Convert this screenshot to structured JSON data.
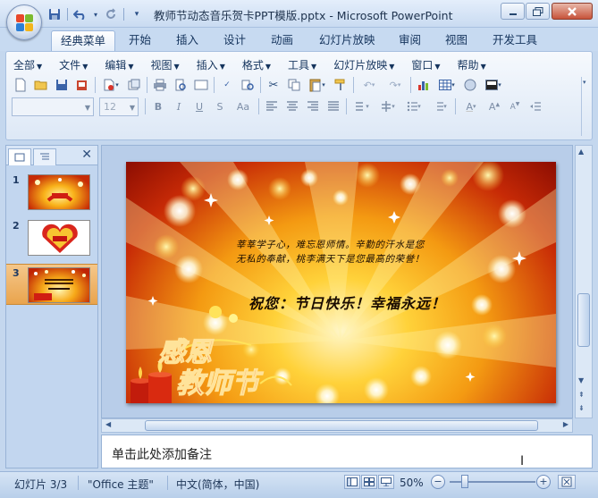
{
  "window": {
    "title": "教师节动态音乐贺卡PPT模版.pptx - Microsoft PowerPoint",
    "controls": [
      "minimize-icon",
      "maximize-icon",
      "close-icon"
    ]
  },
  "quick_access": {
    "icons": [
      "save-icon",
      "undo-icon",
      "redo-icon",
      "customize-icon"
    ]
  },
  "ribbon_tabs": [
    {
      "label": "经典菜单",
      "active": true
    },
    {
      "label": "开始"
    },
    {
      "label": "插入"
    },
    {
      "label": "设计"
    },
    {
      "label": "动画"
    },
    {
      "label": "幻灯片放映"
    },
    {
      "label": "审阅"
    },
    {
      "label": "视图"
    },
    {
      "label": "开发工具"
    }
  ],
  "classic_menu": [
    "全部",
    "文件",
    "编辑",
    "视图",
    "插入",
    "格式",
    "工具",
    "幻灯片放映",
    "窗口",
    "帮助"
  ],
  "toolbar": {
    "font_name": "",
    "font_size": "12",
    "font_style_labels": [
      "B",
      "I",
      "U",
      "S",
      "Aa"
    ]
  },
  "slide_panel": {
    "tab_icons": [
      "slides-tab-icon",
      "outline-tab-icon"
    ],
    "slides": [
      {
        "number": "1"
      },
      {
        "number": "2"
      },
      {
        "number": "3",
        "selected": true
      }
    ]
  },
  "slide": {
    "line1": "莘莘学子心，难忘恩师情。辛勤的汗水是您",
    "line2": "无私的奉献，桃李满天下是您最高的荣誉！",
    "greeting": "祝您：节日快乐！幸福永远！",
    "title_line1": "感恩",
    "title_line2": "教师节"
  },
  "notes": {
    "placeholder": "单击此处添加备注"
  },
  "status_bar": {
    "slide_info": "幻灯片 3/3",
    "theme": "\"Office 主题\"",
    "language": "中文(简体，中国)",
    "zoom": "50%",
    "zoom_minus": "−",
    "zoom_plus": "+"
  },
  "colors": {
    "ribbon_blue": "#c7daf1",
    "selected_thumb": "#e9a44d",
    "slide_red": "#c72a06",
    "slide_gold": "#ffd23a"
  }
}
